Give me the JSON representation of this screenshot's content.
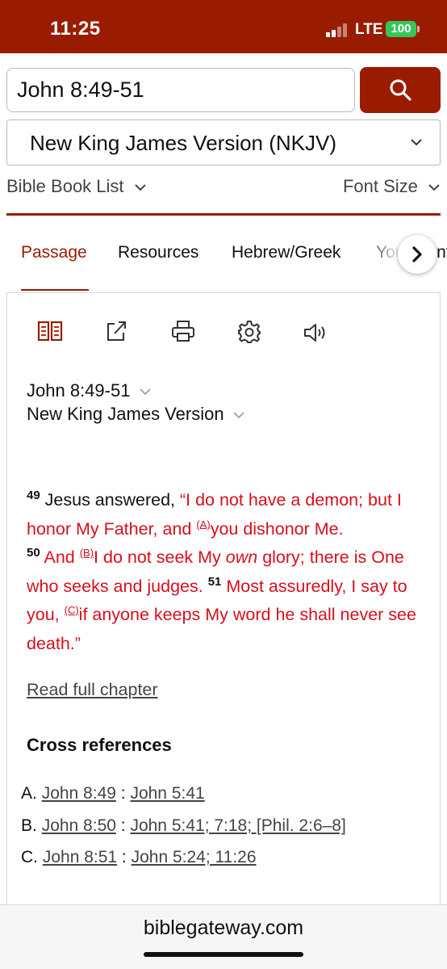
{
  "status_bar": {
    "time": "11:25",
    "network": "LTE",
    "battery": "100"
  },
  "search": {
    "query": "John 8:49-51",
    "button_icon": "search-icon"
  },
  "version_select": {
    "selected": "New King James Version (NKJV)"
  },
  "nav": {
    "book_list": "Bible Book List",
    "font_size": "Font Size"
  },
  "tabs": [
    {
      "label": "Passage",
      "active": true
    },
    {
      "label": "Resources",
      "active": false
    },
    {
      "label": "Hebrew/Greek",
      "active": false
    },
    {
      "label": "Your Content",
      "active": false
    }
  ],
  "toolbar": {
    "icons": [
      "parallel-icon",
      "share-icon",
      "print-icon",
      "settings-icon",
      "audio-icon"
    ]
  },
  "passage": {
    "reference": "John 8:49-51",
    "version": "New King James Version",
    "v49_num": "49",
    "v49_text": "Jesus answered, ",
    "v49_red_a": "“I do not have a demon; but I honor My Father, and ",
    "fn_a": "(A)",
    "v49_red_b": "you dishonor Me.",
    "v50_num": "50",
    "v50_red_a": " And ",
    "fn_b": "(B)",
    "v50_red_b": "I do not seek My ",
    "v50_italic": "own",
    "v50_red_c": " glory; there is One who seeks and judges. ",
    "v51_num": "51",
    "v51_red_a": " Most assuredly, I say to you, ",
    "fn_c": "(C)",
    "v51_red_b": "if anyone keeps My word he shall never see death.”"
  },
  "read_full_chapter": "Read full chapter",
  "cross_references": {
    "title": "Cross references",
    "items": [
      {
        "letter": "A.",
        "source": "John 8:49",
        "sep": " : ",
        "target": "John 5:41"
      },
      {
        "letter": "B.",
        "source": "John 8:50",
        "sep": " : ",
        "target": "John 5:41; 7:18; [Phil. 2:6–8]"
      },
      {
        "letter": "C.",
        "source": "John 8:51",
        "sep": " : ",
        "target": "John 5:24; 11:26"
      }
    ]
  },
  "footer": {
    "domain": "biblegateway.com"
  },
  "colors": {
    "brand": "#9a1c00",
    "words_of_christ": "#d6101c"
  }
}
